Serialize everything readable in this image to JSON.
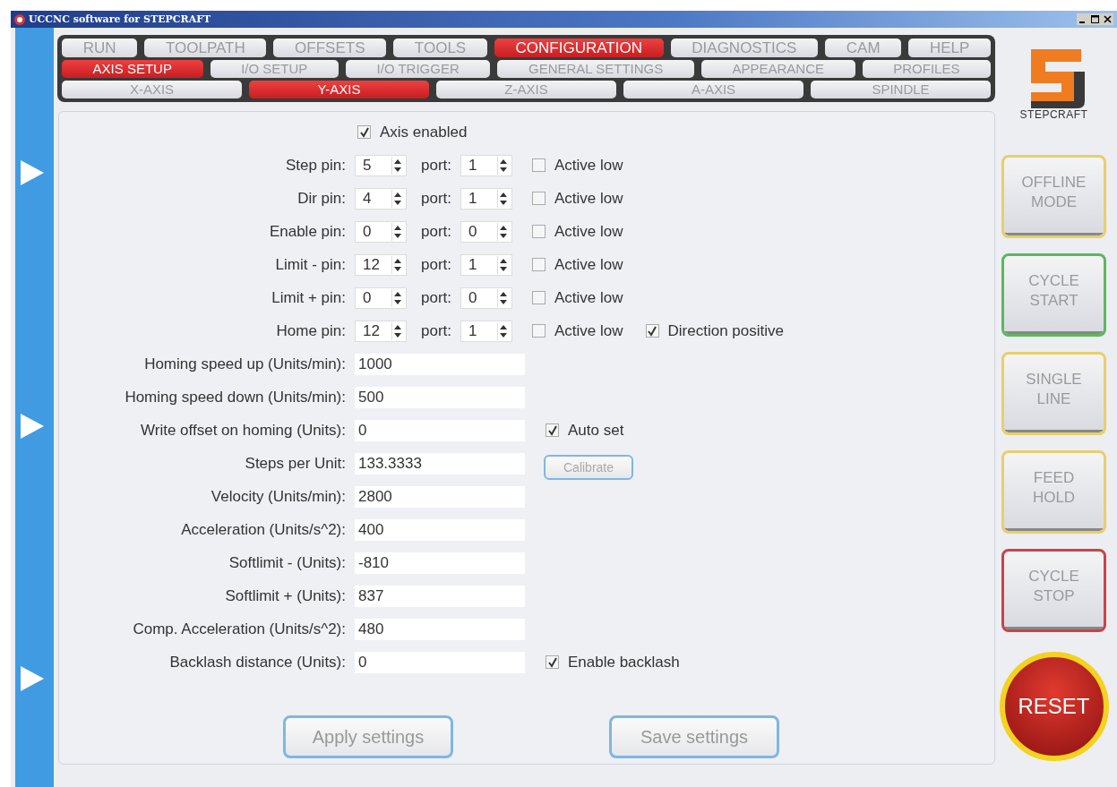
{
  "window": {
    "title": "UCCNC software for STEPCRAFT"
  },
  "main_tabs": [
    {
      "label": "RUN",
      "selected": false
    },
    {
      "label": "TOOLPATH",
      "selected": false
    },
    {
      "label": "OFFSETS",
      "selected": false
    },
    {
      "label": "TOOLS",
      "selected": false
    },
    {
      "label": "CONFIGURATION",
      "selected": true
    },
    {
      "label": "DIAGNOSTICS",
      "selected": false
    },
    {
      "label": "CAM",
      "selected": false
    },
    {
      "label": "HELP",
      "selected": false
    }
  ],
  "sub_tabs": [
    {
      "label": "AXIS SETUP",
      "selected": true
    },
    {
      "label": "I/O SETUP",
      "selected": false
    },
    {
      "label": "I/O  TRIGGER",
      "selected": false
    },
    {
      "label": "GENERAL SETTINGS",
      "selected": false
    },
    {
      "label": "APPEARANCE",
      "selected": false
    },
    {
      "label": "PROFILES",
      "selected": false
    }
  ],
  "axis_tabs": [
    {
      "label": "X-AXIS",
      "selected": false
    },
    {
      "label": "Y-AXIS",
      "selected": true
    },
    {
      "label": "Z-AXIS",
      "selected": false
    },
    {
      "label": "A-AXIS",
      "selected": false
    },
    {
      "label": "SPINDLE",
      "selected": false
    }
  ],
  "logo": {
    "text": "STEPCRAFT"
  },
  "axis_enabled": {
    "label": "Axis enabled",
    "checked": true
  },
  "pin_rows": [
    {
      "label": "Step pin:",
      "pin": "5",
      "port_label": "port:",
      "port": "1",
      "active_low": {
        "label": "Active low",
        "checked": false
      }
    },
    {
      "label": "Dir pin:",
      "pin": "4",
      "port_label": "port:",
      "port": "1",
      "active_low": {
        "label": "Active low",
        "checked": false
      }
    },
    {
      "label": "Enable pin:",
      "pin": "0",
      "port_label": "port:",
      "port": "0",
      "active_low": {
        "label": "Active low",
        "checked": false
      }
    },
    {
      "label": "Limit - pin:",
      "pin": "12",
      "port_label": "port:",
      "port": "1",
      "active_low": {
        "label": "Active low",
        "checked": false
      }
    },
    {
      "label": "Limit + pin:",
      "pin": "0",
      "port_label": "port:",
      "port": "0",
      "active_low": {
        "label": "Active low",
        "checked": false
      }
    },
    {
      "label": "Home pin:",
      "pin": "12",
      "port_label": "port:",
      "port": "1",
      "active_low": {
        "label": "Active low",
        "checked": false
      },
      "extra": {
        "label": "Direction positive",
        "checked": true
      }
    }
  ],
  "field_rows": [
    {
      "label": "Homing speed up (Units/min):",
      "value": "1000"
    },
    {
      "label": "Homing speed down (Units/min):",
      "value": "500"
    },
    {
      "label": "Write offset on homing (Units):",
      "value": "0",
      "extra": {
        "kind": "checkbox",
        "label": "Auto set",
        "checked": true
      }
    },
    {
      "label": "Steps per Unit:",
      "value": "133.3333",
      "extra": {
        "kind": "button",
        "label": "Calibrate"
      }
    },
    {
      "label": "Velocity (Units/min):",
      "value": "2800"
    },
    {
      "label": "Acceleration (Units/s^2):",
      "value": "400"
    },
    {
      "label": "Softlimit - (Units):",
      "value": "-810"
    },
    {
      "label": "Softlimit + (Units):",
      "value": "837"
    },
    {
      "label": "Comp. Acceleration (Units/s^2):",
      "value": "480"
    },
    {
      "label": "Backlash distance (Units):",
      "value": "0",
      "extra": {
        "kind": "checkbox",
        "label": "Enable backlash",
        "checked": true
      }
    }
  ],
  "actions": [
    "Apply settings",
    "Save settings"
  ],
  "side_buttons": [
    {
      "label": "OFFLINE MODE",
      "color": "#e8cf6a"
    },
    {
      "label": "CYCLE START",
      "color": "#5cb85c"
    },
    {
      "label": "SINGLE LINE",
      "color": "#e8cf6a"
    },
    {
      "label": "FEED HOLD",
      "color": "#e8cf6a"
    },
    {
      "label": "CYCLE STOP",
      "color": "#c9434a"
    }
  ],
  "reset": {
    "label": "RESET"
  }
}
